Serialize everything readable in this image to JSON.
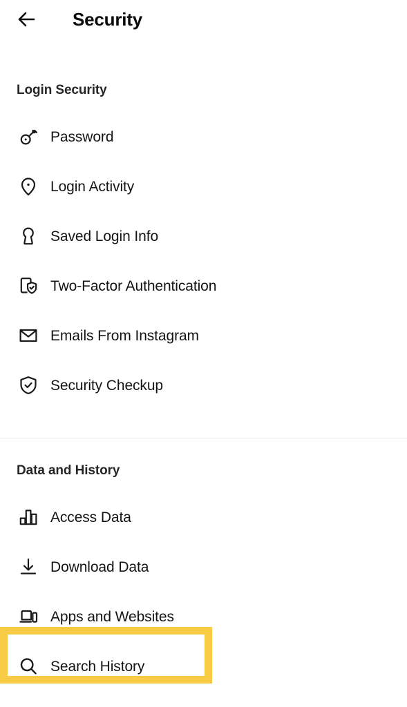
{
  "header": {
    "back_icon": "arrow-left-icon",
    "title": "Security"
  },
  "sections": [
    {
      "id": "login",
      "title": "Login Security",
      "items": [
        {
          "label": "Password",
          "icon": "key-icon"
        },
        {
          "label": "Login Activity",
          "icon": "location-pin-icon"
        },
        {
          "label": "Saved Login Info",
          "icon": "keyhole-icon"
        },
        {
          "label": "Two-Factor Authentication",
          "icon": "phone-shield-check-icon"
        },
        {
          "label": "Emails From Instagram",
          "icon": "envelope-icon"
        },
        {
          "label": "Security Checkup",
          "icon": "shield-check-icon"
        }
      ]
    },
    {
      "id": "data",
      "title": "Data and History",
      "items": [
        {
          "label": "Access Data",
          "icon": "bar-chart-icon"
        },
        {
          "label": "Download Data",
          "icon": "download-arrow-icon"
        },
        {
          "label": "Apps and Websites",
          "icon": "laptop-phone-icon"
        },
        {
          "label": "Search History",
          "icon": "search-icon",
          "highlighted": true
        }
      ]
    }
  ],
  "annotation": {
    "name": "highlight-box",
    "target_label": "Search History",
    "color": "#f8cb45"
  }
}
